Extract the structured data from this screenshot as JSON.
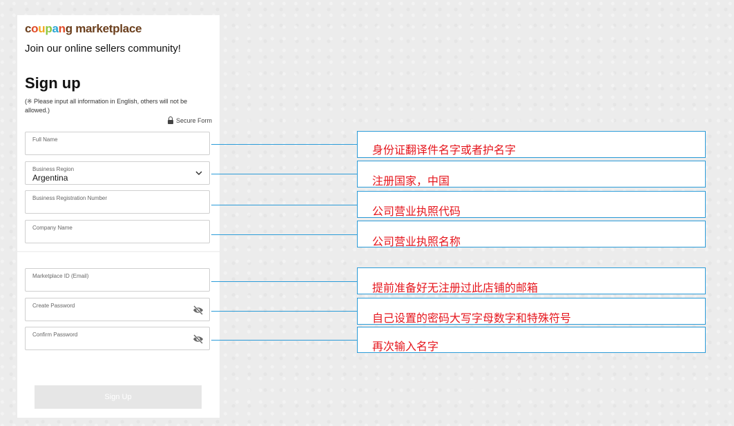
{
  "brand": {
    "letters": [
      {
        "ch": "c",
        "color": "#6b3f1d"
      },
      {
        "ch": "o",
        "color": "#e14b28"
      },
      {
        "ch": "u",
        "color": "#f2a81d"
      },
      {
        "ch": "p",
        "color": "#8cc63f"
      },
      {
        "ch": "a",
        "color": "#2aa6d4"
      },
      {
        "ch": "n",
        "color": "#e14b28"
      },
      {
        "ch": "g",
        "color": "#6b3f1d"
      }
    ],
    "suffix": " marketplace",
    "suffix_color": "#6b3f1d"
  },
  "form": {
    "tagline": "Join our online sellers community!",
    "title": "Sign up",
    "note": "(※ Please input all information in English, others will not be allowed.)",
    "secure_label": "Secure Form",
    "fields": [
      {
        "label": "Full Name",
        "value": ""
      },
      {
        "label": "Business Region",
        "value": "Argentina"
      },
      {
        "label": "Business Registration Number",
        "value": ""
      },
      {
        "label": "Company Name",
        "value": ""
      },
      {
        "label": "Marketplace ID (Email)",
        "value": ""
      },
      {
        "label": "Create Password",
        "value": ""
      },
      {
        "label": "Confirm Password",
        "value": ""
      }
    ],
    "submit_label": "Sign Up"
  },
  "annotations": [
    "身份证翻译件名字或者护名字",
    "注册国家，中国",
    "公司营业执照代码",
    "公司营业执照名称",
    "提前准备好无注册过此店铺的邮箱",
    "自己设置的密码大写字母数字和特殊符号",
    "再次输入名字"
  ],
  "colors": {
    "annotation_text": "#e5161d",
    "annotation_border": "#2a9bd8",
    "button_disabled": "#e6e6e6"
  }
}
